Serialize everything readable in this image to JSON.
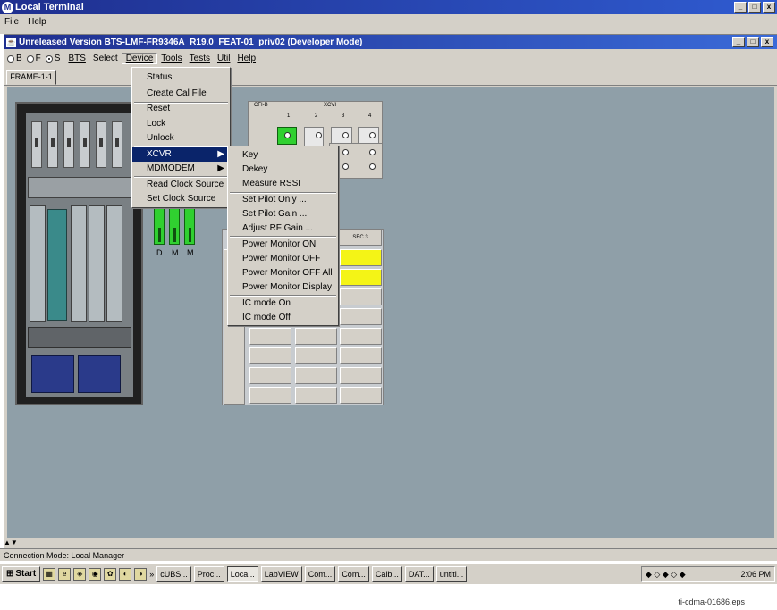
{
  "outer_window": {
    "title": "Local Terminal",
    "menu": [
      "File",
      "Help"
    ],
    "controls": [
      "_",
      "□",
      "x"
    ]
  },
  "inner_window": {
    "title": "Unreleased Version BTS-LMF-FR9346A_R19.0_FEAT-01_priv02 (Developer Mode)",
    "radios": [
      {
        "label": "B",
        "selected": false
      },
      {
        "label": "F",
        "selected": false
      },
      {
        "label": "S",
        "selected": true
      }
    ],
    "menu": [
      "BTS",
      "Select",
      "Device",
      "Tools",
      "Tests",
      "Util",
      "Help"
    ],
    "active_menu": "Device",
    "tab": "FRAME-1-1"
  },
  "device_menu": {
    "items": [
      "Status",
      "Create Cal File",
      "Reset",
      "Lock",
      "Unlock",
      "XCVR",
      "MDMODEM",
      "Read Clock Source",
      "Set Clock Source"
    ],
    "highlighted": "XCVR",
    "submenu_arrow": "▶"
  },
  "xcvr_submenu": {
    "items": [
      "Key",
      "Dekey",
      "Measure RSSI",
      "Set Pilot Only ...",
      "Set Pilot Gain ...",
      "Adjust RF Gain ...",
      "Power Monitor ON",
      "Power Monitor OFF",
      "Power Monitor OFF All",
      "Power Monitor Display",
      "IC mode On",
      "IC mode Off"
    ]
  },
  "panel": {
    "dmm_labels": [
      "D",
      "M",
      "M"
    ],
    "xcvr_header_left": "CFI-B",
    "xcvr_header_right": "XCVI",
    "xcvr_numbers": [
      "1",
      "2",
      "3",
      "4"
    ],
    "sector_header": "SEC 3"
  },
  "status_bar": {
    "text": "Connection Mode: Local Manager"
  },
  "taskbar": {
    "start": "Start",
    "more": "»",
    "buttons": [
      "cUBS...",
      "Proc...",
      "Loca...",
      "LabVIEW",
      "Com...",
      "Com...",
      "Calb...",
      "DAT...",
      "untitl..."
    ],
    "active_button": "Loca...",
    "time": "2:06 PM"
  },
  "caption": "ti-cdma-01686.eps",
  "colors": {
    "title_bar": "#1f2f8f",
    "highlight": "#0a246a",
    "workspace": "#8f9fa8",
    "green_led": "#30d030",
    "yellow_cell": "#f4f416"
  }
}
